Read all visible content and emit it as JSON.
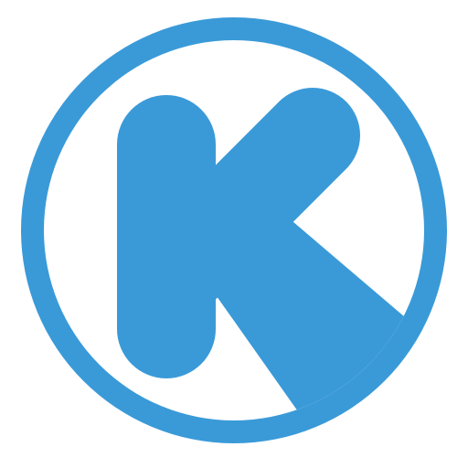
{
  "logo": {
    "icon": "k-letter-logo-icon",
    "letter": "K",
    "colors": {
      "brand_blue": "#3A9AD8",
      "ring_white": "#FFFFFF",
      "background": "#FFFFFF"
    }
  }
}
